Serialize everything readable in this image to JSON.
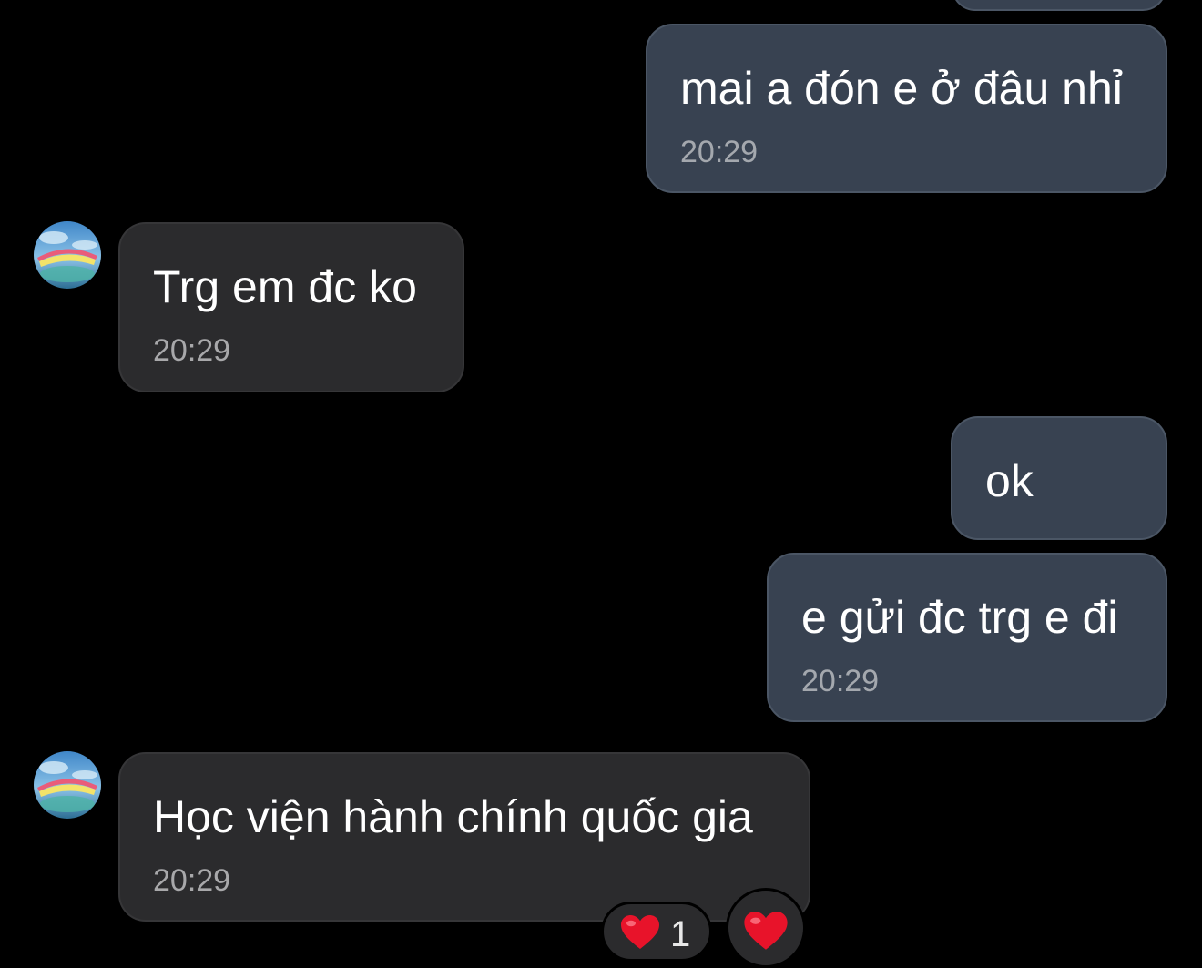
{
  "messages": [
    {
      "direction": "sent",
      "text": "mai a đón e ở đâu nhỉ",
      "time": "20:29"
    },
    {
      "direction": "received",
      "text": "Trg em đc ko",
      "time": "20:29"
    },
    {
      "direction": "sent",
      "text": "ok"
    },
    {
      "direction": "sent",
      "text": "e gửi đc trg e đi",
      "time": "20:29"
    },
    {
      "direction": "received",
      "text": "Học viện hành chính quốc gia",
      "time": "20:29"
    }
  ],
  "reactions": {
    "count_heart": "1",
    "icon": "heart-icon",
    "heart_color": "#e8132a"
  },
  "colors": {
    "background": "#000000",
    "sent_bubble": "#384251",
    "received_bubble": "#2b2b2d",
    "timestamp": "#a4a8ae"
  }
}
